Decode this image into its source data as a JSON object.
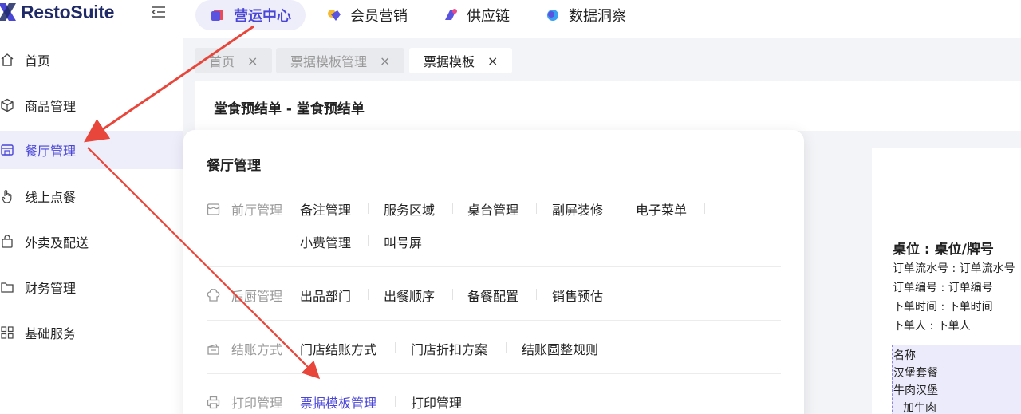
{
  "app": {
    "brand": "RestoSuite"
  },
  "top_nav": [
    {
      "label": "营运中心",
      "icon": "cube-icon",
      "active": true
    },
    {
      "label": "会员营销",
      "icon": "diamond-icon",
      "active": false
    },
    {
      "label": "供应链",
      "icon": "supply-icon",
      "active": false
    },
    {
      "label": "数据洞察",
      "icon": "insight-icon",
      "active": false
    }
  ],
  "sidebar": {
    "items": [
      {
        "label": "首页",
        "icon": "home-icon"
      },
      {
        "label": "商品管理",
        "icon": "box-icon"
      },
      {
        "label": "餐厅管理",
        "icon": "store-icon",
        "active": true
      },
      {
        "label": "线上点餐",
        "icon": "hand-icon"
      },
      {
        "label": "外卖及配送",
        "icon": "bag-icon"
      },
      {
        "label": "财务管理",
        "icon": "folder-icon"
      },
      {
        "label": "基础服务",
        "icon": "grid-icon"
      }
    ]
  },
  "tabs": [
    {
      "label": "首页",
      "close": "×"
    },
    {
      "label": "票据模板管理",
      "close": "×"
    },
    {
      "label": "票据模板",
      "close": "×",
      "active": true
    }
  ],
  "page": {
    "title": "堂食预结单 - 堂食预结单"
  },
  "receipt": {
    "table_line": "桌位 : 桌位/牌号",
    "lines": [
      "订单流水号 : 订单流水号",
      "订单编号 : 订单编号",
      "下单时间 : 下单时间",
      "下单人 : 下单人"
    ],
    "items": [
      "名称",
      "汉堡套餐",
      "牛肉汉堡",
      "加牛肉"
    ]
  },
  "panel": {
    "title": "餐厅管理",
    "groups": [
      {
        "name": "前厅管理",
        "icon": "storefront-icon",
        "links": [
          "备注管理",
          "服务区域",
          "桌台管理",
          "副屏装修",
          "电子菜单",
          "小费管理",
          "叫号屏"
        ]
      },
      {
        "name": "后厨管理",
        "icon": "chef-hat-icon",
        "links": [
          "出品部门",
          "出餐顺序",
          "备餐配置",
          "销售预估"
        ]
      },
      {
        "name": "结账方式",
        "icon": "checkout-icon",
        "links": [
          "门店结账方式",
          "门店折扣方案",
          "结账圆整规则"
        ]
      },
      {
        "name": "打印管理",
        "icon": "printer-icon",
        "links": [
          "票据模板管理",
          "打印管理"
        ],
        "active_link": "票据模板管理"
      }
    ]
  },
  "colors": {
    "accent": "#4a46d6",
    "arrow": "#e8463a",
    "brand": "#1f2a66"
  }
}
